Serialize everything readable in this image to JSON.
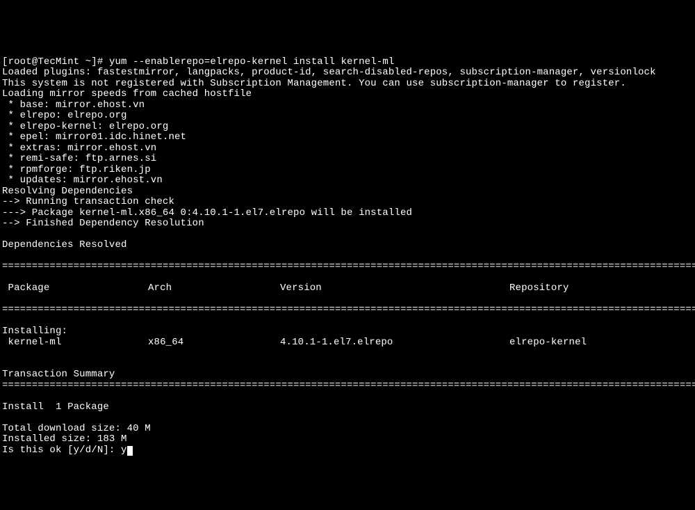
{
  "prompt": {
    "open": "[",
    "user_host": "root@TecMint",
    "path": " ~",
    "close": "]# ",
    "command": "yum --enablerepo=elrepo-kernel install kernel-ml"
  },
  "output": {
    "loaded_plugins": "Loaded plugins: fastestmirror, langpacks, product-id, search-disabled-repos, subscription-manager, versionlock",
    "not_registered": "This system is not registered with Subscription Management. You can use subscription-manager to register.",
    "loading_mirror": "Loading mirror speeds from cached hostfile",
    "mirrors": [
      " * base: mirror.ehost.vn",
      " * elrepo: elrepo.org",
      " * elrepo-kernel: elrepo.org",
      " * epel: mirror01.idc.hinet.net",
      " * extras: mirror.ehost.vn",
      " * remi-safe: ftp.arnes.si",
      " * rpmforge: ftp.riken.jp",
      " * updates: mirror.ehost.vn"
    ],
    "resolving": "Resolving Dependencies",
    "running_check": "--> Running transaction check",
    "pkg_line": "---> Package kernel-ml.x86_64 0:4.10.1-1.el7.elrepo will be installed",
    "finished": "--> Finished Dependency Resolution",
    "deps_resolved": "Dependencies Resolved",
    "headers": {
      "pkg": " Package",
      "arch": "Arch",
      "ver": "Version",
      "repo": "Repository"
    },
    "installing": "Installing:",
    "row": {
      "pkg": " kernel-ml",
      "arch": "x86_64",
      "ver": "4.10.1-1.el7.elrepo",
      "repo": "elrepo-kernel"
    },
    "tx_summary": "Transaction Summary",
    "install_count": "Install  1 Package",
    "dl_size": "Total download size: 40 M",
    "inst_size": "Installed size: 183 M",
    "confirm": "Is this ok [y/d/N]: ",
    "confirm_input": "y"
  }
}
